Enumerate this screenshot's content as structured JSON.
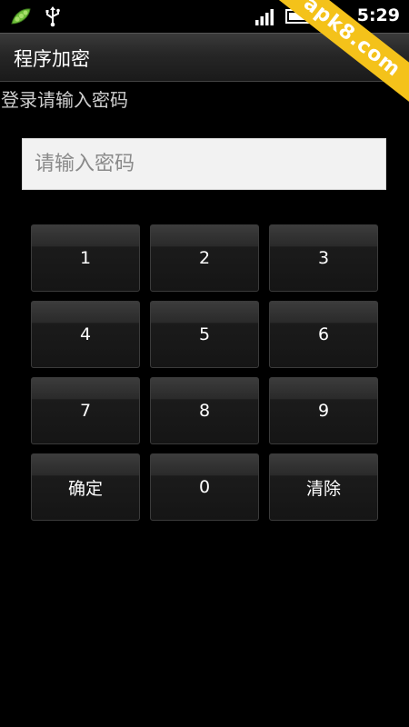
{
  "status_bar": {
    "time": "5:29",
    "icons": [
      "pea-pod-icon",
      "usb-icon",
      "signal-icon",
      "battery-icon",
      "alarm-icon"
    ]
  },
  "watermark": {
    "text": "apk8.com",
    "color": "#f4c21a"
  },
  "title_bar": {
    "title": "程序加密"
  },
  "prompt": "登录请输入密码",
  "password_input": {
    "value": "",
    "placeholder": "请输入密码"
  },
  "keypad": {
    "keys": [
      {
        "label": "1"
      },
      {
        "label": "2"
      },
      {
        "label": "3"
      },
      {
        "label": "4"
      },
      {
        "label": "5"
      },
      {
        "label": "6"
      },
      {
        "label": "7"
      },
      {
        "label": "8"
      },
      {
        "label": "9"
      },
      {
        "label": "确定"
      },
      {
        "label": "0"
      },
      {
        "label": "清除"
      }
    ]
  }
}
